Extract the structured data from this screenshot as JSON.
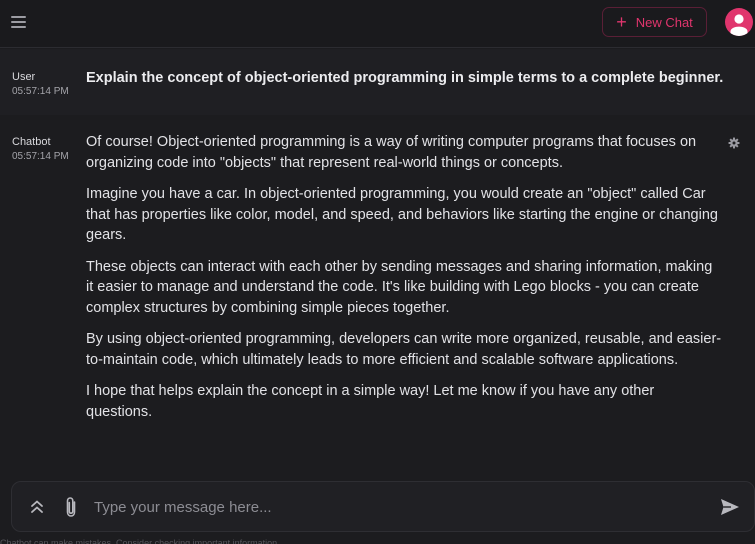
{
  "header": {
    "new_chat_label": "New Chat"
  },
  "messages": [
    {
      "role": "User",
      "time": "05:57:14 PM",
      "text": "Explain the concept of object-oriented programming in simple terms to a complete beginner."
    },
    {
      "role": "Chatbot",
      "time": "05:57:14 PM",
      "paragraphs": [
        "Of course! Object-oriented programming is a way of writing computer programs that focuses on organizing code into \"objects\" that represent real-world things or concepts.",
        "Imagine you have a car. In object-oriented programming, you would create an \"object\" called Car that has properties like color, model, and speed, and behaviors like starting the engine or changing gears.",
        "These objects can interact with each other by sending messages and sharing information, making it easier to manage and understand the code. It's like building with Lego blocks - you can create complex structures by combining simple pieces together.",
        "By using object-oriented programming, developers can write more organized, reusable, and easier-to-maintain code, which ultimately leads to more efficient and scalable software applications.",
        "I hope that helps explain the concept in a simple way! Let me know if you have any other questions."
      ]
    }
  ],
  "composer": {
    "placeholder": "Type your message here...",
    "footer_note": "Chatbot can make mistakes. Consider checking important information."
  },
  "icons": {
    "menu": "hamburger-menu-icon",
    "new_chat": "plus-icon",
    "avatar": "user-avatar-icon",
    "settings": "gear-icon",
    "expand": "chevrons-up-icon",
    "attach": "paperclip-icon",
    "send": "paper-plane-icon"
  },
  "colors": {
    "accent": "#e0356d",
    "background": "#1c1c1f",
    "user_row": "#1f1f23"
  }
}
